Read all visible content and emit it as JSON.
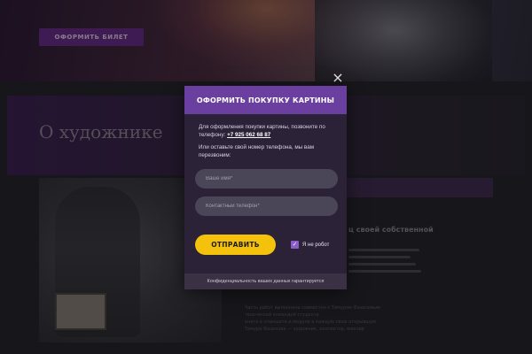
{
  "hero": {
    "button_label": "ОФОРМИТЬ БИЛЕТ"
  },
  "about": {
    "title": "О художнике",
    "side_heading": "ц своей собственной",
    "faint_lines": [
      "Часть работ выполнена совместно с Тимуром Фазиловым",
      "творческой командой студента",
      "книга в планшете и модуле в каждую свою открывшую",
      "Тимура Фазилова — художник, коллектор, ювелир"
    ]
  },
  "modal": {
    "title": "ОФОРМИТЬ ПОКУПКУ КАРТИНЫ",
    "desc_prefix": "Для оформления покупки картины, позвоните по телефону:",
    "phone": "+7 925 062 68 87",
    "desc_alt": "Или оставьте свой номер телефона, мы вам перезвоним:",
    "name_placeholder": "Ваше имя*",
    "phone_placeholder": "Контактный телефон*",
    "submit_label": "ОТПРАВИТЬ",
    "captcha_label": "Я не робот",
    "captcha_checked": true,
    "close_icon": "×",
    "check_icon": "✓",
    "footer": "Конфиденциальность ваших данных гарантируется"
  },
  "colors": {
    "header": "#6b3fa0",
    "modal_bg": "#2b2237",
    "submit": "#f4c20d",
    "checkbox": "#8a5cc8"
  }
}
